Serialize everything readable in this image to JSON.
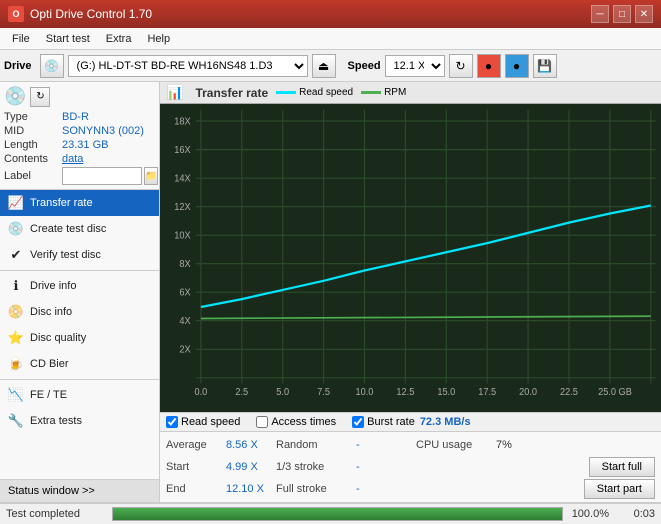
{
  "titleBar": {
    "title": "Opti Drive Control 1.70",
    "icon": "O",
    "minimizeLabel": "─",
    "maximizeLabel": "□",
    "closeLabel": "✕"
  },
  "menuBar": {
    "items": [
      "File",
      "Start test",
      "Extra",
      "Help"
    ]
  },
  "driveToolbar": {
    "driveLabel": "Drive",
    "driveValue": "(G:) HL-DT-ST BD-RE  WH16NS48 1.D3",
    "speedLabel": "Speed",
    "speedValue": "12.1 X"
  },
  "disc": {
    "typeLabel": "Type",
    "typeValue": "BD-R",
    "midLabel": "MID",
    "midValue": "SONYNN3 (002)",
    "lengthLabel": "Length",
    "lengthValue": "23.31 GB",
    "contentsLabel": "Contents",
    "contentsValue": "data",
    "labelLabel": "Label",
    "labelPlaceholder": ""
  },
  "nav": {
    "items": [
      {
        "id": "transfer-rate",
        "label": "Transfer rate",
        "icon": "📈",
        "active": true
      },
      {
        "id": "create-test-disc",
        "label": "Create test disc",
        "icon": "💿"
      },
      {
        "id": "verify-test-disc",
        "label": "Verify test disc",
        "icon": "✔"
      },
      {
        "id": "drive-info",
        "label": "Drive info",
        "icon": "ℹ"
      },
      {
        "id": "disc-info",
        "label": "Disc info",
        "icon": "📀"
      },
      {
        "id": "disc-quality",
        "label": "Disc quality",
        "icon": "⭐"
      },
      {
        "id": "cd-bier",
        "label": "CD Bier",
        "icon": "🍺"
      },
      {
        "id": "fe-te",
        "label": "FE / TE",
        "icon": "📉"
      },
      {
        "id": "extra-tests",
        "label": "Extra tests",
        "icon": "🔧"
      }
    ],
    "statusWindow": "Status window >>"
  },
  "chart": {
    "title": "Transfer rate",
    "icon": "📊",
    "legendReadSpeed": "Read speed",
    "legendRPM": "RPM",
    "readSpeedColor": "#00e5ff",
    "rpmColor": "#4caf50",
    "yAxisLabels": [
      "18X",
      "16X",
      "14X",
      "12X",
      "10X",
      "8X",
      "6X",
      "4X",
      "2X"
    ],
    "xAxisLabels": [
      "0.0",
      "2.5",
      "5.0",
      "7.5",
      "10.0",
      "12.5",
      "15.0",
      "17.5",
      "20.0",
      "22.5",
      "25.0 GB"
    ]
  },
  "checkboxes": {
    "readSpeed": {
      "label": "Read speed",
      "checked": true
    },
    "accessTimes": {
      "label": "Access times",
      "checked": false
    },
    "burstRate": {
      "label": "Burst rate",
      "checked": true
    },
    "burstValue": "72.3 MB/s"
  },
  "dataRows": [
    {
      "col1": "Average",
      "val1": "8.56 X",
      "col2": "Random",
      "val2": "-",
      "col3": "CPU usage",
      "val3": "7%",
      "buttonLabel": null
    },
    {
      "col1": "Start",
      "val1": "4.99 X",
      "col2": "1/3 stroke",
      "val2": "-",
      "col3": "",
      "val3": "",
      "buttonLabel": "Start full"
    },
    {
      "col1": "End",
      "val1": "12.10 X",
      "col2": "Full stroke",
      "val2": "-",
      "col3": "",
      "val3": "",
      "buttonLabel": "Start part"
    }
  ],
  "statusBar": {
    "text": "Test completed",
    "progressPct": 100,
    "progressLabel": "100.0%",
    "time": "0:03"
  }
}
